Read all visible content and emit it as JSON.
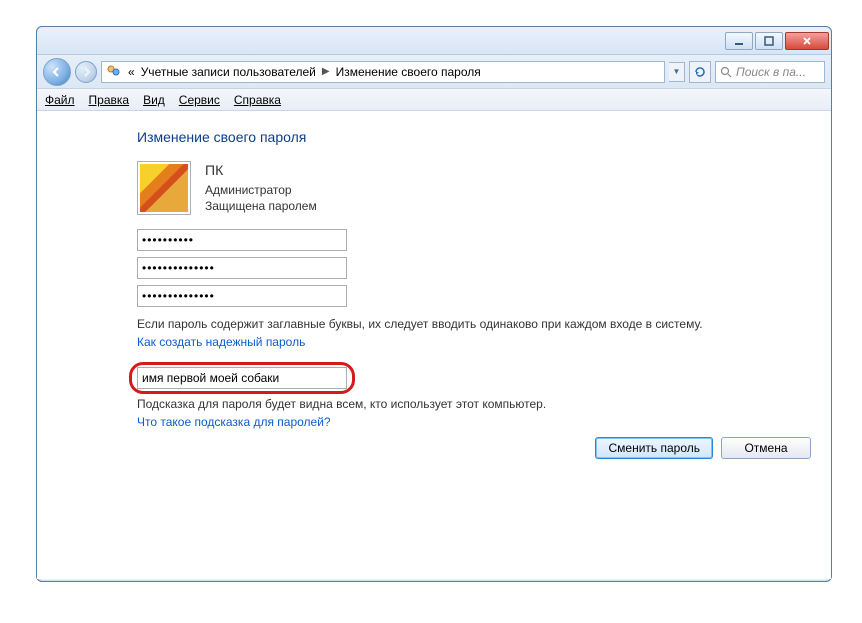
{
  "window": {
    "min_tooltip": "Свернуть",
    "max_tooltip": "Развернуть",
    "close_tooltip": "Закрыть"
  },
  "addressbar": {
    "prefix": "«",
    "crumb1": "Учетные записи пользователей",
    "crumb2": "Изменение своего пароля"
  },
  "search": {
    "placeholder": "Поиск в па..."
  },
  "menu": {
    "file": "Файл",
    "edit": "Правка",
    "view": "Вид",
    "tools": "Сервис",
    "help": "Справка"
  },
  "page": {
    "title": "Изменение своего пароля",
    "user": {
      "name": "ПК",
      "role": "Администратор",
      "status": "Защищена паролем"
    },
    "pwd_current": "••••••••••",
    "pwd_new": "••••••••••••••",
    "pwd_confirm": "••••••••••••••",
    "caps_info": "Если пароль содержит заглавные буквы, их следует вводить одинаково при каждом входе в систему.",
    "strong_link": "Как создать надежный пароль",
    "hint_value": "имя первой моей собаки",
    "hint_info": "Подсказка для пароля будет видна всем, кто использует этот компьютер.",
    "hint_link": "Что такое подсказка для паролей?"
  },
  "buttons": {
    "primary": "Сменить пароль",
    "cancel": "Отмена"
  }
}
